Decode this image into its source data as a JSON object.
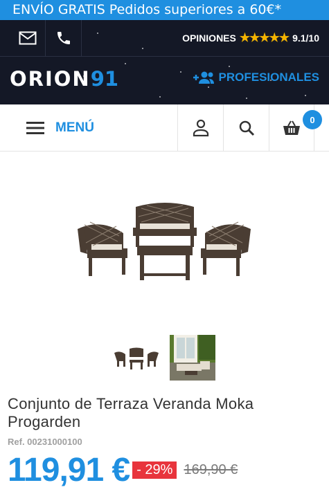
{
  "promo": {
    "text": "ENVÍO GRATIS Pedidos superiores a 60€*"
  },
  "header": {
    "icons": [
      "mail-icon",
      "phone-icon"
    ],
    "reviews_label": "OPINIONES",
    "rating_stars": "★★★★★",
    "rating_value": "9.1/10",
    "logo_text": "ORION",
    "logo_number": "91",
    "professionals_label": "PROFESIONALES"
  },
  "nav": {
    "menu_label": "MENÚ",
    "icons": [
      "user-icon",
      "search-icon",
      "basket-icon"
    ],
    "cart_count": "0"
  },
  "product": {
    "title": "Conjunto de Terraza Veranda Moka Progarden",
    "ref": "Ref. 00231000100",
    "price": "119,91 €",
    "discount": "- 29%",
    "old_price": "169,90 €",
    "thumbnail_count": 2
  },
  "colors": {
    "brand_blue": "#1f8fe0",
    "header_dark": "#141826",
    "discount_red": "#e8343c",
    "rating_gold": "#f4b400"
  }
}
